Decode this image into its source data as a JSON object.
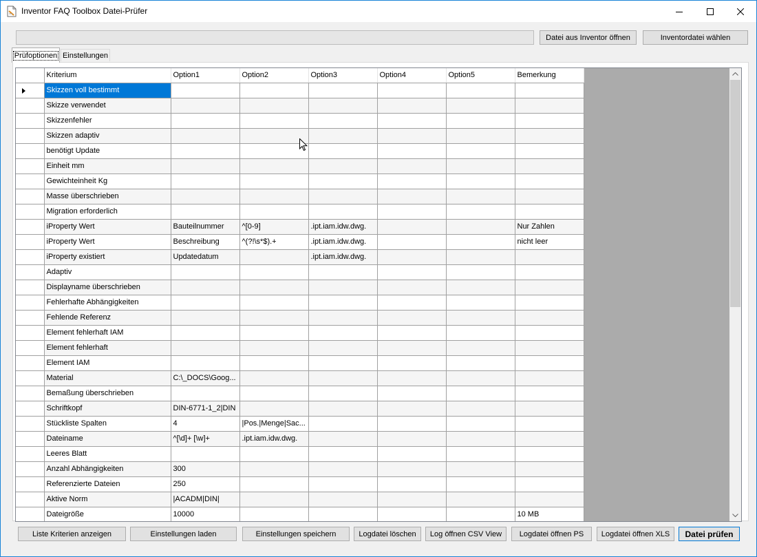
{
  "window": {
    "title": "Inventor FAQ Toolbox Datei-Prüfer"
  },
  "top": {
    "open_from_inventor": "Datei aus Inventor öffnen",
    "choose_file": "Inventordatei wählen"
  },
  "tabs": [
    {
      "label": "Prüfoptionen",
      "active": true
    },
    {
      "label": "Einstellungen",
      "active": false
    }
  ],
  "grid": {
    "columns": [
      "Kriterium",
      "Option1",
      "Option2",
      "Option3",
      "Option4",
      "Option5",
      "Bemerkung"
    ],
    "rows": [
      [
        "Skizzen voll bestimmt",
        "",
        "",
        "",
        "",
        "",
        ""
      ],
      [
        "Skizze verwendet",
        "",
        "",
        "",
        "",
        "",
        ""
      ],
      [
        "Skizzenfehler",
        "",
        "",
        "",
        "",
        "",
        ""
      ],
      [
        "Skizzen adaptiv",
        "",
        "",
        "",
        "",
        "",
        ""
      ],
      [
        "benötigt Update",
        "",
        "",
        "",
        "",
        "",
        ""
      ],
      [
        "Einheit mm",
        "",
        "",
        "",
        "",
        "",
        ""
      ],
      [
        "Gewichteinheit Kg",
        "",
        "",
        "",
        "",
        "",
        ""
      ],
      [
        "Masse überschrieben",
        "",
        "",
        "",
        "",
        "",
        ""
      ],
      [
        "Migration erforderlich",
        "",
        "",
        "",
        "",
        "",
        ""
      ],
      [
        "iProperty Wert",
        "Bauteilnummer",
        "^[0-9]",
        ".ipt.iam.idw.dwg.",
        "",
        "",
        "Nur Zahlen"
      ],
      [
        "iProperty Wert",
        "Beschreibung",
        "^(?!\\s*$).+",
        ".ipt.iam.idw.dwg.",
        "",
        "",
        "nicht leer"
      ],
      [
        "iProperty existiert",
        "Updatedatum",
        "",
        ".ipt.iam.idw.dwg.",
        "",
        "",
        ""
      ],
      [
        "Adaptiv",
        "",
        "",
        "",
        "",
        "",
        ""
      ],
      [
        "Displayname überschrieben",
        "",
        "",
        "",
        "",
        "",
        ""
      ],
      [
        "Fehlerhafte Abhängigkeiten",
        "",
        "",
        "",
        "",
        "",
        ""
      ],
      [
        "Fehlende Referenz",
        "",
        "",
        "",
        "",
        "",
        ""
      ],
      [
        "Element fehlerhaft IAM",
        "",
        "",
        "",
        "",
        "",
        ""
      ],
      [
        "Element fehlerhaft",
        "",
        "",
        "",
        "",
        "",
        ""
      ],
      [
        "Element IAM",
        "",
        "",
        "",
        "",
        "",
        ""
      ],
      [
        "Material",
        "C:\\_DOCS\\Goog...",
        "",
        "",
        "",
        "",
        ""
      ],
      [
        "Bemaßung überschrieben",
        "",
        "",
        "",
        "",
        "",
        ""
      ],
      [
        "Schriftkopf",
        "DIN-6771-1_2|DIN",
        "",
        "",
        "",
        "",
        ""
      ],
      [
        "Stückliste Spalten",
        "4",
        "|Pos.|Menge|Sac...",
        "",
        "",
        "",
        ""
      ],
      [
        "Dateiname",
        "^[\\d]+ [\\w]+",
        ".ipt.iam.idw.dwg.",
        "",
        "",
        "",
        ""
      ],
      [
        "Leeres Blatt",
        "",
        "",
        "",
        "",
        "",
        ""
      ],
      [
        "Anzahl Abhängigkeiten",
        "300",
        "",
        "",
        "",
        "",
        ""
      ],
      [
        "Referenzierte Dateien",
        "250",
        "",
        "",
        "",
        "",
        ""
      ],
      [
        "Aktive Norm",
        "|ACADM|DIN|",
        "",
        "",
        "",
        "",
        ""
      ],
      [
        "Dateigröße",
        "10000",
        "",
        "",
        "",
        "",
        "10 MB"
      ]
    ]
  },
  "bottom": {
    "show_criteria": "Liste Kriterien anzeigen",
    "load_settings": "Einstellungen laden",
    "save_settings": "Einstellungen speichern",
    "delete_log": "Logdatei löschen",
    "open_log_csv": "Log öffnen CSV View",
    "open_log_ps": "Logdatei öffnen PS",
    "open_log_xls": "Logdatei öffnen XLS",
    "check_file": "Datei prüfen"
  },
  "colors": {
    "selection": "#0078d7",
    "window_border": "#1883d7",
    "grid_background": "#ababab"
  }
}
